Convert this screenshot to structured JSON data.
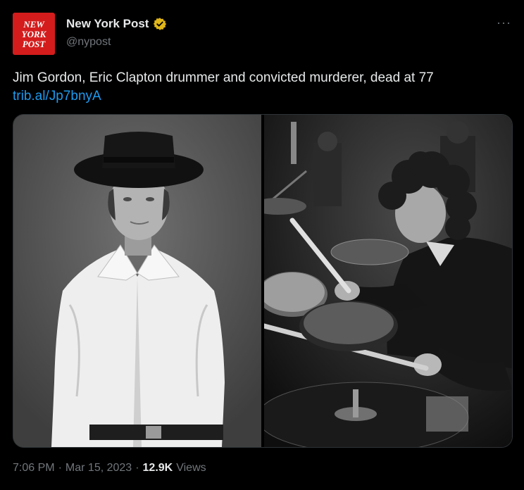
{
  "author": {
    "display_name": "New York Post",
    "handle": "@nypost",
    "avatar_lines": [
      "NEW",
      "YORK",
      "POST"
    ],
    "verified_color": "#e2b719",
    "avatar_color": "#d41c1c"
  },
  "tweet": {
    "text": "Jim Gordon, Eric Clapton drummer and convicted murderer, dead at 77",
    "link": "trib.al/Jp7bnyA"
  },
  "media": {
    "images": [
      "portrait-photo",
      "drumming-photo"
    ]
  },
  "meta": {
    "time": "7:06 PM",
    "separator": "·",
    "date": "Mar 15, 2023",
    "views_count": "12.9K",
    "views_label": "Views"
  },
  "more_label": "···",
  "colors": {
    "background": "#000000",
    "text": "#e7e9ea",
    "secondary": "#71767b",
    "link": "#1d9bf0"
  }
}
